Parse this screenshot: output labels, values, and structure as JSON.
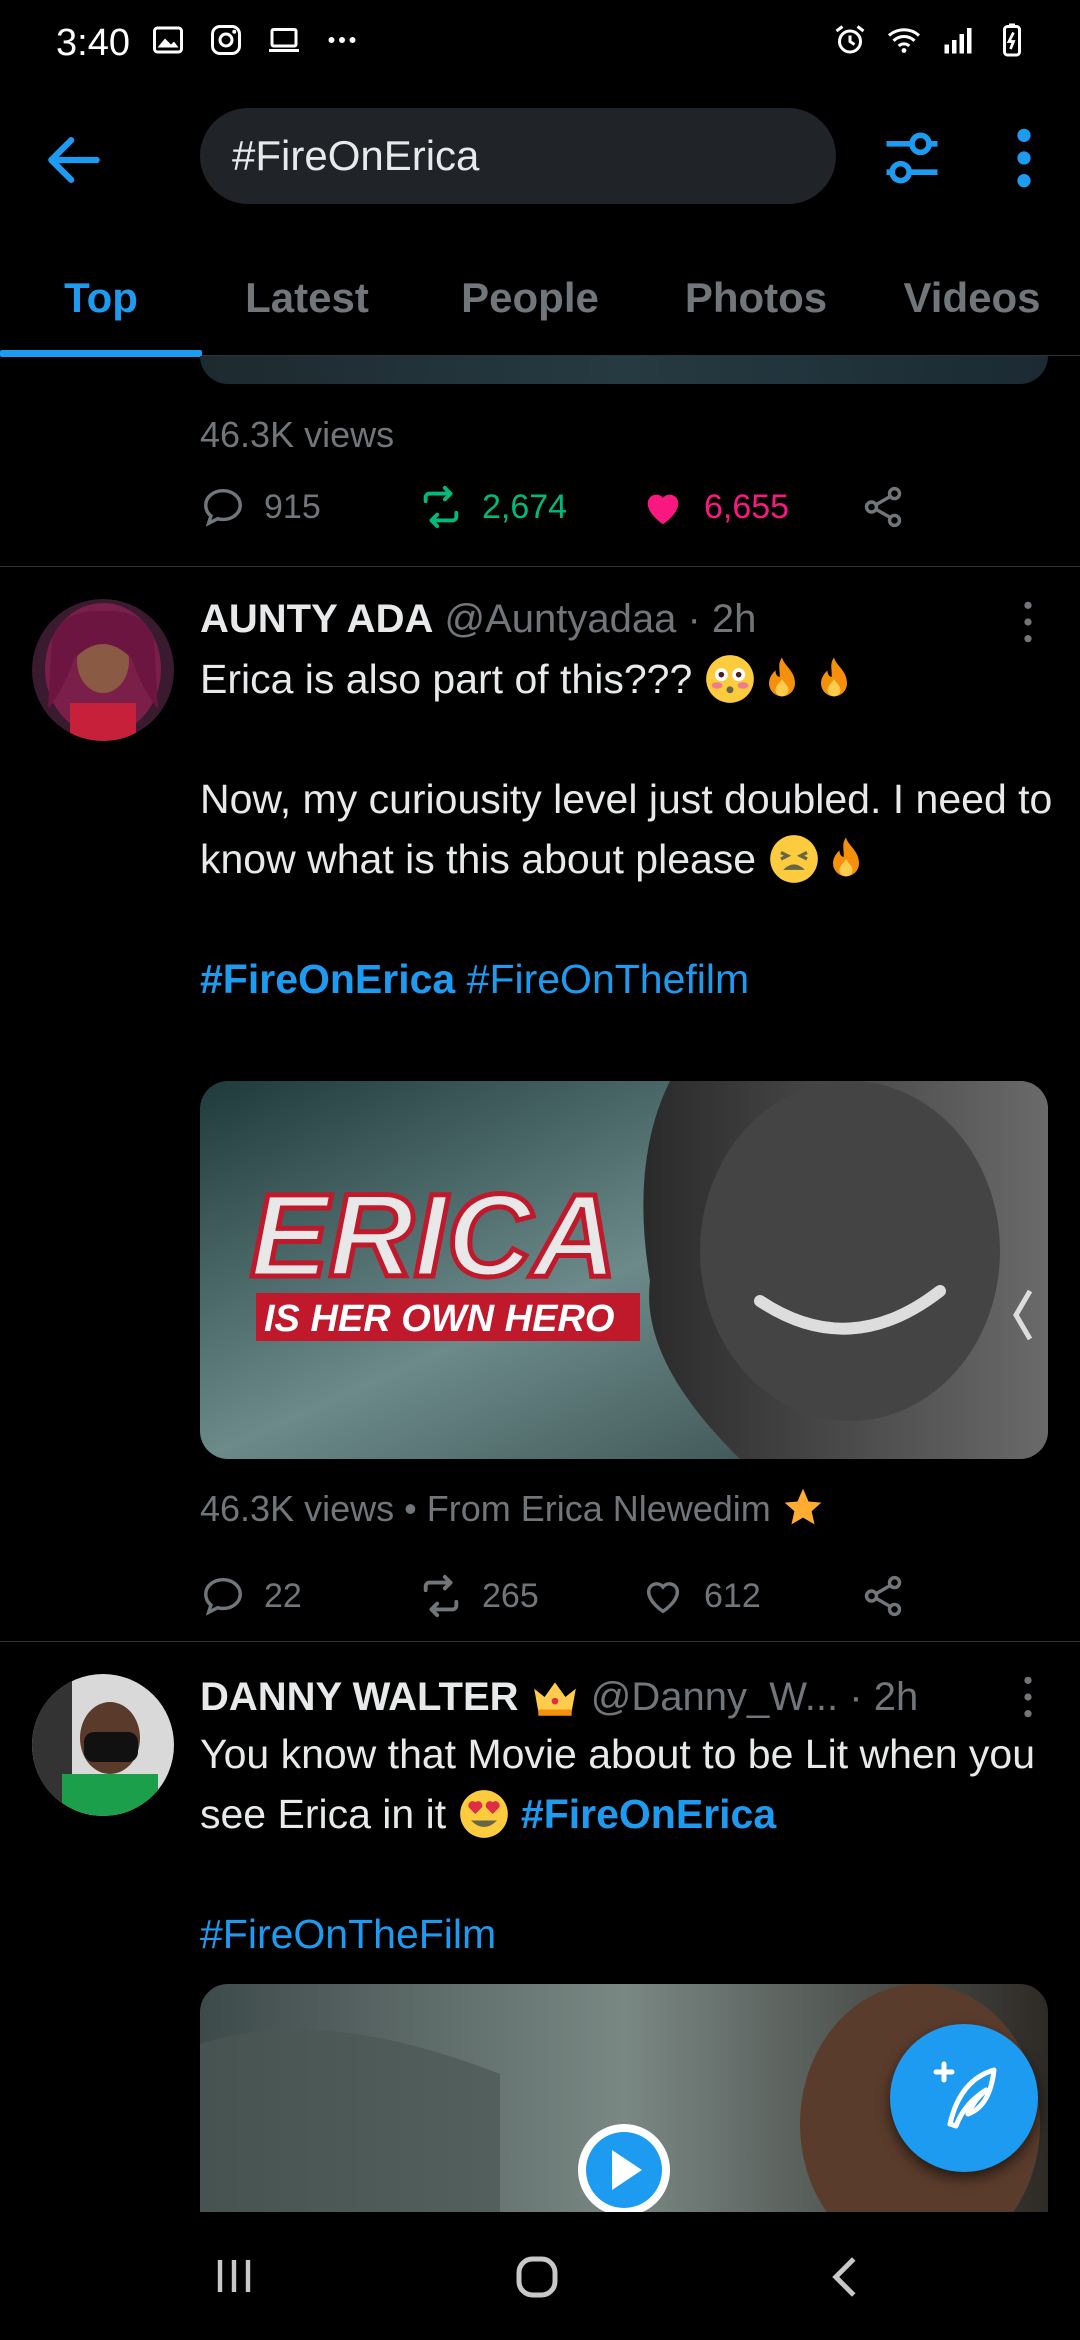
{
  "status_bar": {
    "time": "3:40",
    "left_icons": [
      "gallery-icon",
      "instagram-icon",
      "laptop-icon",
      "more-dots-icon"
    ],
    "right_icons": [
      "alarm-icon",
      "wifi-icon",
      "signal-icon",
      "battery-icon"
    ]
  },
  "search": {
    "query": "#FireOnErica"
  },
  "tabs": [
    {
      "label": "Top",
      "active": true
    },
    {
      "label": "Latest",
      "active": false
    },
    {
      "label": "People",
      "active": false
    },
    {
      "label": "Photos",
      "active": false
    },
    {
      "label": "Videos",
      "active": false
    }
  ],
  "previous_tweet": {
    "views": "46.3K views",
    "replies": "915",
    "retweets": "2,674",
    "likes": "6,655"
  },
  "tweets": [
    {
      "name": "AUNTY ADA",
      "handle": "@Auntyadaa",
      "time": "· 2h",
      "line1": "Erica is also part of this???",
      "line2": "Now, my curiousity level just doubled. I need to know what is this about please",
      "hashtag1": "#FireOnErica",
      "hashtag2": "#FireOnThefilm",
      "media_title": "ERICA",
      "media_subtitle": "IS HER OWN HERO",
      "views": "46.3K views",
      "from": "From Erica Nlewedim",
      "replies": "22",
      "retweets": "265",
      "likes": "612"
    },
    {
      "name": "DANNY WALTER",
      "handle": "@Danny_W...",
      "time": "· 2h",
      "line1": "You know that Movie about to be Lit when you see Erica in it",
      "hashtag1": "#FireOnErica",
      "hashtag2": "#FireOnTheFilm"
    }
  ],
  "colors": {
    "accent": "#1d9bf0",
    "retweet_active": "#00ba7c",
    "like_active": "#f91880",
    "muted": "#71767b",
    "background": "#000000"
  }
}
